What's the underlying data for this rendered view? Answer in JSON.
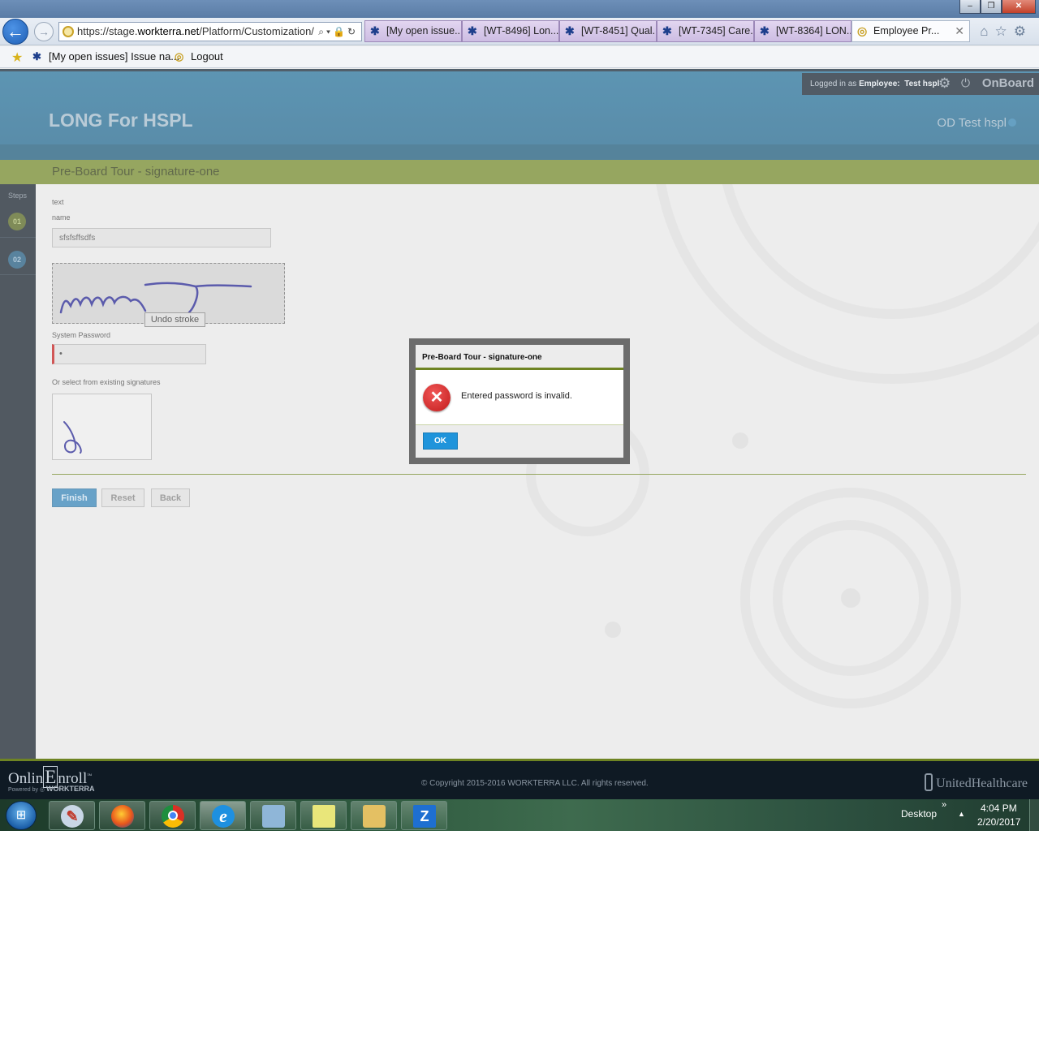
{
  "browser": {
    "url_prefix": "https://stage.",
    "url_domain": "workterra.net",
    "url_path": "/Platform/Customization/",
    "tabs": [
      {
        "title": "[My open issue..."
      },
      {
        "title": "[WT-8496] Lon..."
      },
      {
        "title": "[WT-8451] Qual..."
      },
      {
        "title": "[WT-7345] Care..."
      },
      {
        "title": "[WT-8364] LON..."
      },
      {
        "title": "Employee Pr...",
        "active": true
      }
    ],
    "favorites": [
      {
        "label": "[My open issues] Issue na...",
        "icon": "jira-icon"
      },
      {
        "label": "Logout",
        "icon": "ie-page-icon"
      }
    ]
  },
  "app": {
    "title": "LONG For HSPL",
    "user_display": "OD Test hspl",
    "logged_in_prefix": "Logged in as ",
    "logged_in_role": "Employee:",
    "logged_in_user": "Test hspl",
    "product": "OnBoard",
    "step_title": "Pre-Board Tour - signature-one",
    "steps_label": "Steps",
    "steps": [
      "01",
      "02"
    ],
    "current_step": "01"
  },
  "form": {
    "text_label": "text",
    "name_label": "name",
    "name_value": "sfsfsffsdfs",
    "undo_label": "Undo stroke",
    "password_label": "System Password",
    "password_value": "•",
    "existing_label": "Or select from existing signatures",
    "finish_label": "Finish",
    "reset_label": "Reset",
    "back_label": "Back"
  },
  "modal": {
    "title": "Pre-Board Tour - signature-one",
    "message": "Entered password is invalid.",
    "ok_label": "OK",
    "icon": "error-icon"
  },
  "footer": {
    "brand_main": "Onlin",
    "brand_mark": "E",
    "brand_tail": "nroll",
    "brand_tm": "™",
    "powered_by": "Powered by ",
    "powered_brand": "WORKTERRA",
    "copyright": "© Copyright 2015-2016 WORKTERRA LLC. All rights reserved.",
    "partner": "UnitedHealthcare"
  },
  "taskbar": {
    "apps": [
      "paint",
      "firefox",
      "chrome",
      "internet-explorer",
      "sticky-notes-app",
      "sticky-notes",
      "windows-explorer",
      "zoho"
    ],
    "desktop_label": "Desktop",
    "time": "4:04 PM",
    "date": "2/20/2017"
  },
  "colors": {
    "header_blue": "#1f6c96",
    "step_green": "#6e8423",
    "dark_nav": "#0f1a24",
    "ok_blue": "#1f94db",
    "error_red": "#c21c1c"
  }
}
